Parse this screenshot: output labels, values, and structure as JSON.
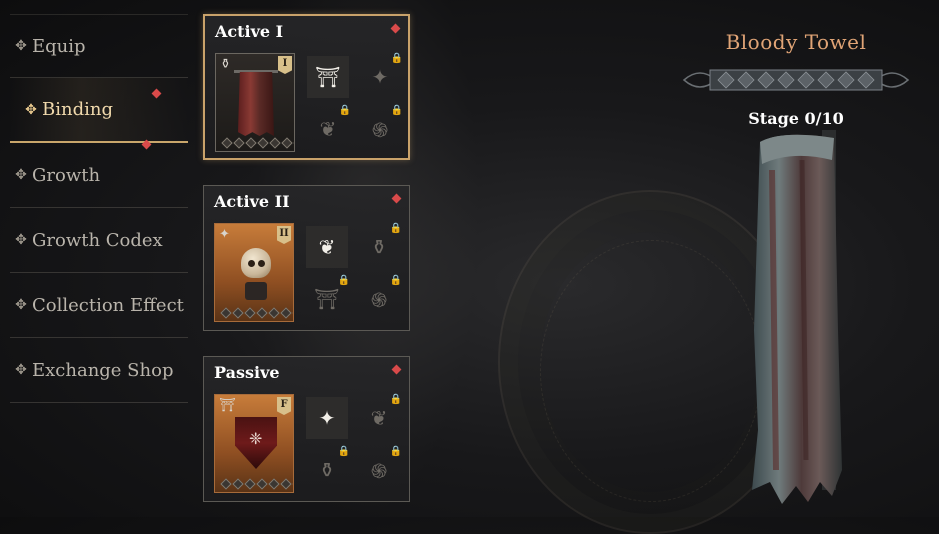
{
  "menu": {
    "items": [
      {
        "label": "Equip"
      },
      {
        "label": "Binding"
      },
      {
        "label": "Growth"
      },
      {
        "label": "Growth Codex"
      },
      {
        "label": "Collection Effect"
      },
      {
        "label": "Exchange Shop"
      }
    ],
    "active_index": 1,
    "item_icon": "four-point-diamond-icon"
  },
  "panels": {
    "active1": {
      "title": "Active I",
      "rank": "I",
      "main_item": "bloody-towel",
      "pips": 7
    },
    "active2": {
      "title": "Active II",
      "rank": "II",
      "main_item": "skull-on-stand",
      "pips": 7
    },
    "passive": {
      "title": "Passive",
      "rank": "F",
      "main_item": "crimson-shield",
      "pips": 7
    }
  },
  "item": {
    "name": "Bloody Towel",
    "stage": "Stage 0/10"
  },
  "colors": {
    "accent_gold": "#c9a26a",
    "item_name": "#e0a476",
    "notification": "#d94a4a"
  }
}
